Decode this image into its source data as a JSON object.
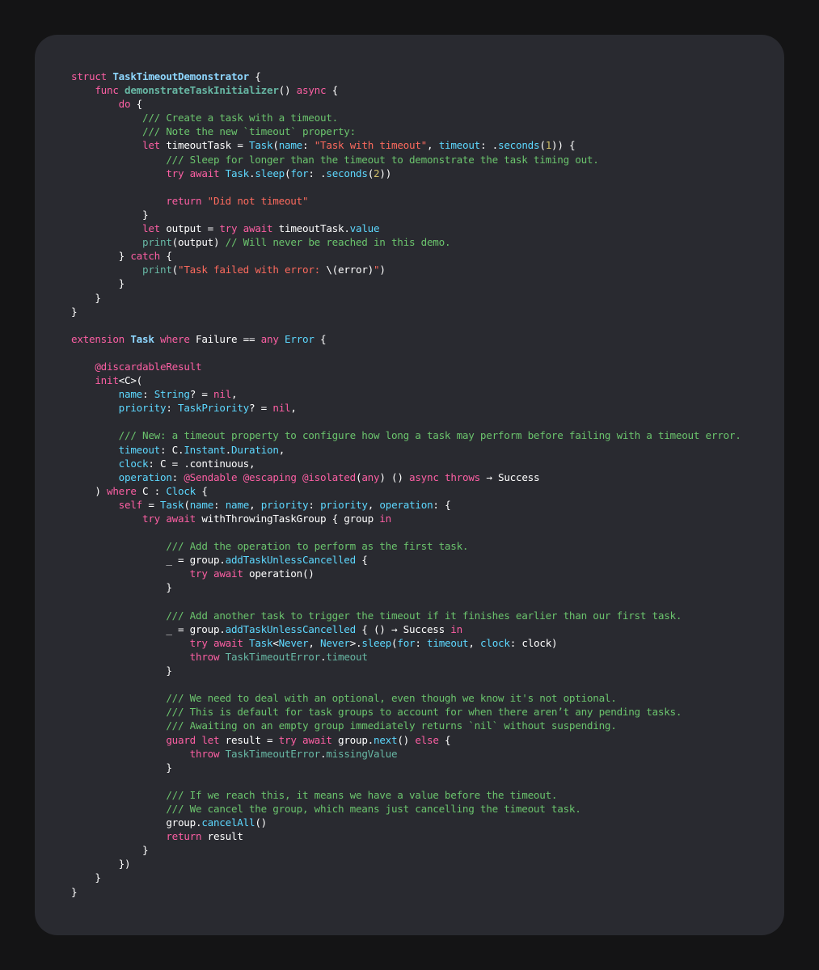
{
  "colors": {
    "background": "#141415",
    "panel": "#292a30",
    "keyword": "#fc5fa3",
    "type_name": "#5dd8ff",
    "declaration": "#8ed7ff",
    "function": "#67b7a4",
    "string": "#fc6a5d",
    "number": "#d0bf69",
    "doc_comment": "#6bc46d",
    "attribute": "#fd8f3f",
    "plain": "#ffffff"
  },
  "code_lines": [
    [
      [
        "kw",
        "struct "
      ],
      [
        "tdecl",
        "TaskTimeoutDemonstrator"
      ],
      [
        "plain",
        " {"
      ]
    ],
    [
      [
        "plain",
        "    "
      ],
      [
        "kw",
        "func "
      ],
      [
        "fdecl",
        "demonstrateTaskInitializer"
      ],
      [
        "plain",
        "() "
      ],
      [
        "kw",
        "async"
      ],
      [
        "plain",
        " {"
      ]
    ],
    [
      [
        "plain",
        "        "
      ],
      [
        "kw",
        "do"
      ],
      [
        "plain",
        " {"
      ]
    ],
    [
      [
        "plain",
        "            "
      ],
      [
        "doc",
        "/// Create a task with a timeout."
      ]
    ],
    [
      [
        "plain",
        "            "
      ],
      [
        "doc",
        "/// Note the new `timeout` property:"
      ]
    ],
    [
      [
        "plain",
        "            "
      ],
      [
        "kw",
        "let "
      ],
      [
        "plain",
        "timeoutTask = "
      ],
      [
        "type",
        "Task"
      ],
      [
        "plain",
        "("
      ],
      [
        "prop",
        "name"
      ],
      [
        "plain",
        ": "
      ],
      [
        "str",
        "\"Task with timeout\""
      ],
      [
        "plain",
        ", "
      ],
      [
        "prop",
        "timeout"
      ],
      [
        "plain",
        ": ."
      ],
      [
        "prop",
        "seconds"
      ],
      [
        "plain",
        "("
      ],
      [
        "num",
        "1"
      ],
      [
        "plain",
        ")) {"
      ]
    ],
    [
      [
        "plain",
        "                "
      ],
      [
        "doc",
        "/// Sleep for longer than the timeout to demonstrate the task timing out."
      ]
    ],
    [
      [
        "plain",
        "                "
      ],
      [
        "kw",
        "try await "
      ],
      [
        "type",
        "Task"
      ],
      [
        "plain",
        "."
      ],
      [
        "prop",
        "sleep"
      ],
      [
        "plain",
        "("
      ],
      [
        "prop",
        "for"
      ],
      [
        "plain",
        ": ."
      ],
      [
        "prop",
        "seconds"
      ],
      [
        "plain",
        "("
      ],
      [
        "num",
        "2"
      ],
      [
        "plain",
        "))"
      ]
    ],
    [
      [
        "plain",
        ""
      ]
    ],
    [
      [
        "plain",
        "                "
      ],
      [
        "kw",
        "return "
      ],
      [
        "str",
        "\"Did not timeout\""
      ]
    ],
    [
      [
        "plain",
        "            }"
      ]
    ],
    [
      [
        "plain",
        "            "
      ],
      [
        "kw",
        "let "
      ],
      [
        "plain",
        "output = "
      ],
      [
        "kw",
        "try await "
      ],
      [
        "plain",
        "timeoutTask."
      ],
      [
        "prop",
        "value"
      ]
    ],
    [
      [
        "plain",
        "            "
      ],
      [
        "fn",
        "print"
      ],
      [
        "plain",
        "(output) "
      ],
      [
        "doc",
        "// Will never be reached in this demo."
      ]
    ],
    [
      [
        "plain",
        "        } "
      ],
      [
        "kw",
        "catch"
      ],
      [
        "plain",
        " {"
      ]
    ],
    [
      [
        "plain",
        "            "
      ],
      [
        "fn",
        "print"
      ],
      [
        "plain",
        "("
      ],
      [
        "str",
        "\"Task failed with error: "
      ],
      [
        "plain",
        "\\(error)"
      ],
      [
        "str",
        "\""
      ],
      [
        "plain",
        ")"
      ]
    ],
    [
      [
        "plain",
        "        }"
      ]
    ],
    [
      [
        "plain",
        "    }"
      ]
    ],
    [
      [
        "plain",
        "}"
      ]
    ],
    [
      [
        "plain",
        ""
      ]
    ],
    [
      [
        "kw",
        "extension "
      ],
      [
        "tdecl",
        "Task "
      ],
      [
        "kw",
        "where "
      ],
      [
        "plain",
        "Failure == "
      ],
      [
        "kw",
        "any "
      ],
      [
        "type",
        "Error"
      ],
      [
        "plain",
        " {"
      ]
    ],
    [
      [
        "plain",
        ""
      ]
    ],
    [
      [
        "plain",
        "    "
      ],
      [
        "kw",
        "@discardableResult"
      ]
    ],
    [
      [
        "plain",
        "    "
      ],
      [
        "kw",
        "init"
      ],
      [
        "plain",
        "<C>("
      ]
    ],
    [
      [
        "plain",
        "        "
      ],
      [
        "prop",
        "name"
      ],
      [
        "plain",
        ": "
      ],
      [
        "type",
        "String"
      ],
      [
        "plain",
        "? = "
      ],
      [
        "kw",
        "nil"
      ],
      [
        "plain",
        ","
      ]
    ],
    [
      [
        "plain",
        "        "
      ],
      [
        "prop",
        "priority"
      ],
      [
        "plain",
        ": "
      ],
      [
        "type",
        "TaskPriority"
      ],
      [
        "plain",
        "? = "
      ],
      [
        "kw",
        "nil"
      ],
      [
        "plain",
        ","
      ]
    ],
    [
      [
        "plain",
        ""
      ]
    ],
    [
      [
        "plain",
        "        "
      ],
      [
        "doc",
        "/// New: a timeout property to configure how long a task may perform before failing with a timeout error."
      ]
    ],
    [
      [
        "plain",
        "        "
      ],
      [
        "prop",
        "timeout"
      ],
      [
        "plain",
        ": C."
      ],
      [
        "type",
        "Instant"
      ],
      [
        "plain",
        "."
      ],
      [
        "type",
        "Duration"
      ],
      [
        "plain",
        ","
      ]
    ],
    [
      [
        "plain",
        "        "
      ],
      [
        "prop",
        "clock"
      ],
      [
        "plain",
        ": C = .continuous,"
      ]
    ],
    [
      [
        "plain",
        "        "
      ],
      [
        "prop",
        "operation"
      ],
      [
        "plain",
        ": "
      ],
      [
        "kw",
        "@Sendable @escaping @isolated"
      ],
      [
        "plain",
        "("
      ],
      [
        "kw",
        "any"
      ],
      [
        "plain",
        ") () "
      ],
      [
        "kw",
        "async throws"
      ],
      [
        "plain",
        " → Success"
      ]
    ],
    [
      [
        "plain",
        "    ) "
      ],
      [
        "kw",
        "where "
      ],
      [
        "plain",
        "C : "
      ],
      [
        "type",
        "Clock"
      ],
      [
        "plain",
        " {"
      ]
    ],
    [
      [
        "plain",
        "        "
      ],
      [
        "kw",
        "self "
      ],
      [
        "plain",
        "= "
      ],
      [
        "type",
        "Task"
      ],
      [
        "plain",
        "("
      ],
      [
        "prop",
        "name"
      ],
      [
        "plain",
        ": "
      ],
      [
        "prop",
        "name"
      ],
      [
        "plain",
        ", "
      ],
      [
        "prop",
        "priority"
      ],
      [
        "plain",
        ": "
      ],
      [
        "prop",
        "priority"
      ],
      [
        "plain",
        ", "
      ],
      [
        "prop",
        "operation"
      ],
      [
        "plain",
        ": {"
      ]
    ],
    [
      [
        "plain",
        "            "
      ],
      [
        "kw",
        "try await "
      ],
      [
        "plain",
        "withThrowingTaskGroup { group "
      ],
      [
        "kw",
        "in"
      ]
    ],
    [
      [
        "plain",
        ""
      ]
    ],
    [
      [
        "plain",
        "                "
      ],
      [
        "doc",
        "/// Add the operation to perform as the first task."
      ]
    ],
    [
      [
        "plain",
        "                _ = group."
      ],
      [
        "prop",
        "addTaskUnlessCancelled"
      ],
      [
        "plain",
        " {"
      ]
    ],
    [
      [
        "plain",
        "                    "
      ],
      [
        "kw",
        "try await "
      ],
      [
        "plain",
        "operation()"
      ]
    ],
    [
      [
        "plain",
        "                }"
      ]
    ],
    [
      [
        "plain",
        ""
      ]
    ],
    [
      [
        "plain",
        "                "
      ],
      [
        "doc",
        "/// Add another task to trigger the timeout if it finishes earlier than our first task."
      ]
    ],
    [
      [
        "plain",
        "                _ = group."
      ],
      [
        "prop",
        "addTaskUnlessCancelled"
      ],
      [
        "plain",
        " { () → Success "
      ],
      [
        "kw",
        "in"
      ]
    ],
    [
      [
        "plain",
        "                    "
      ],
      [
        "kw",
        "try await "
      ],
      [
        "type",
        "Task"
      ],
      [
        "plain",
        "<"
      ],
      [
        "type",
        "Never"
      ],
      [
        "plain",
        ", "
      ],
      [
        "type",
        "Never"
      ],
      [
        "plain",
        ">."
      ],
      [
        "prop",
        "sleep"
      ],
      [
        "plain",
        "("
      ],
      [
        "prop",
        "for"
      ],
      [
        "plain",
        ": "
      ],
      [
        "prop",
        "timeout"
      ],
      [
        "plain",
        ", "
      ],
      [
        "prop",
        "clock"
      ],
      [
        "plain",
        ": clock)"
      ]
    ],
    [
      [
        "plain",
        "                    "
      ],
      [
        "kw",
        "throw "
      ],
      [
        "fn",
        "TaskTimeoutError"
      ],
      [
        "plain",
        "."
      ],
      [
        "fn",
        "timeout"
      ]
    ],
    [
      [
        "plain",
        "                }"
      ]
    ],
    [
      [
        "plain",
        ""
      ]
    ],
    [
      [
        "plain",
        "                "
      ],
      [
        "doc",
        "/// We need to deal with an optional, even though we know it's not optional."
      ]
    ],
    [
      [
        "plain",
        "                "
      ],
      [
        "doc",
        "/// This is default for task groups to account for when there aren’t any pending tasks."
      ]
    ],
    [
      [
        "plain",
        "                "
      ],
      [
        "doc",
        "/// Awaiting on an empty group immediately returns `nil` without suspending."
      ]
    ],
    [
      [
        "plain",
        "                "
      ],
      [
        "kw",
        "guard let "
      ],
      [
        "plain",
        "result = "
      ],
      [
        "kw",
        "try await "
      ],
      [
        "plain",
        "group."
      ],
      [
        "prop",
        "next"
      ],
      [
        "plain",
        "() "
      ],
      [
        "kw",
        "else"
      ],
      [
        "plain",
        " {"
      ]
    ],
    [
      [
        "plain",
        "                    "
      ],
      [
        "kw",
        "throw "
      ],
      [
        "fn",
        "TaskTimeoutError"
      ],
      [
        "plain",
        "."
      ],
      [
        "fn",
        "missingValue"
      ]
    ],
    [
      [
        "plain",
        "                }"
      ]
    ],
    [
      [
        "plain",
        ""
      ]
    ],
    [
      [
        "plain",
        "                "
      ],
      [
        "doc",
        "/// If we reach this, it means we have a value before the timeout."
      ]
    ],
    [
      [
        "plain",
        "                "
      ],
      [
        "doc",
        "/// We cancel the group, which means just cancelling the timeout task."
      ]
    ],
    [
      [
        "plain",
        "                group."
      ],
      [
        "prop",
        "cancelAll"
      ],
      [
        "plain",
        "()"
      ]
    ],
    [
      [
        "plain",
        "                "
      ],
      [
        "kw",
        "return "
      ],
      [
        "plain",
        "result"
      ]
    ],
    [
      [
        "plain",
        "            }"
      ]
    ],
    [
      [
        "plain",
        "        })"
      ]
    ],
    [
      [
        "plain",
        "    }"
      ]
    ],
    [
      [
        "plain",
        "}"
      ]
    ]
  ]
}
